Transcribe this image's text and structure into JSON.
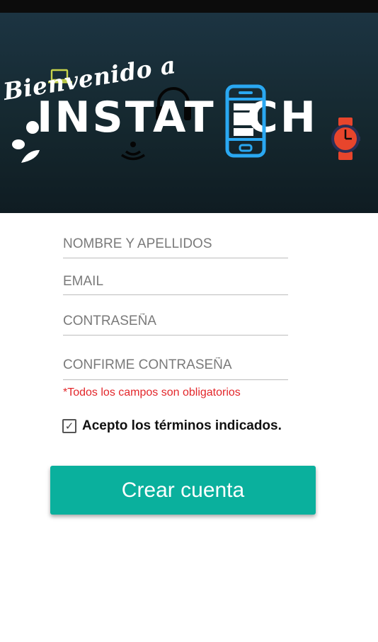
{
  "banner": {
    "welcome_text": "Bienvenido a",
    "brand_prefix": "INSTAT",
    "brand_e": "E",
    "brand_suffix": "CH",
    "colors": {
      "background": "#17303b",
      "phone": "#2aa8f2",
      "laptop": "#c8d44a",
      "watch": "#e8452c"
    },
    "icons": [
      "laptop-icon",
      "headphones-icon",
      "phone-icon",
      "wifi-icon",
      "splash-icon",
      "watch-icon"
    ]
  },
  "form": {
    "fields": [
      {
        "placeholder": "NOMBRE Y APELLIDOS",
        "value": ""
      },
      {
        "placeholder": "EMAIL",
        "value": ""
      },
      {
        "placeholder": "CONTRASEÑA",
        "value": ""
      },
      {
        "placeholder": "CONFIRME CONTRASEÑA",
        "value": ""
      }
    ],
    "required_note": "*Todos los campos son obligatorios",
    "terms_checked": true,
    "terms_label": "Acepto los términos indicados.",
    "submit_label": "Crear cuenta",
    "colors": {
      "accent": "#0ab09d",
      "error": "#e3272b"
    }
  }
}
